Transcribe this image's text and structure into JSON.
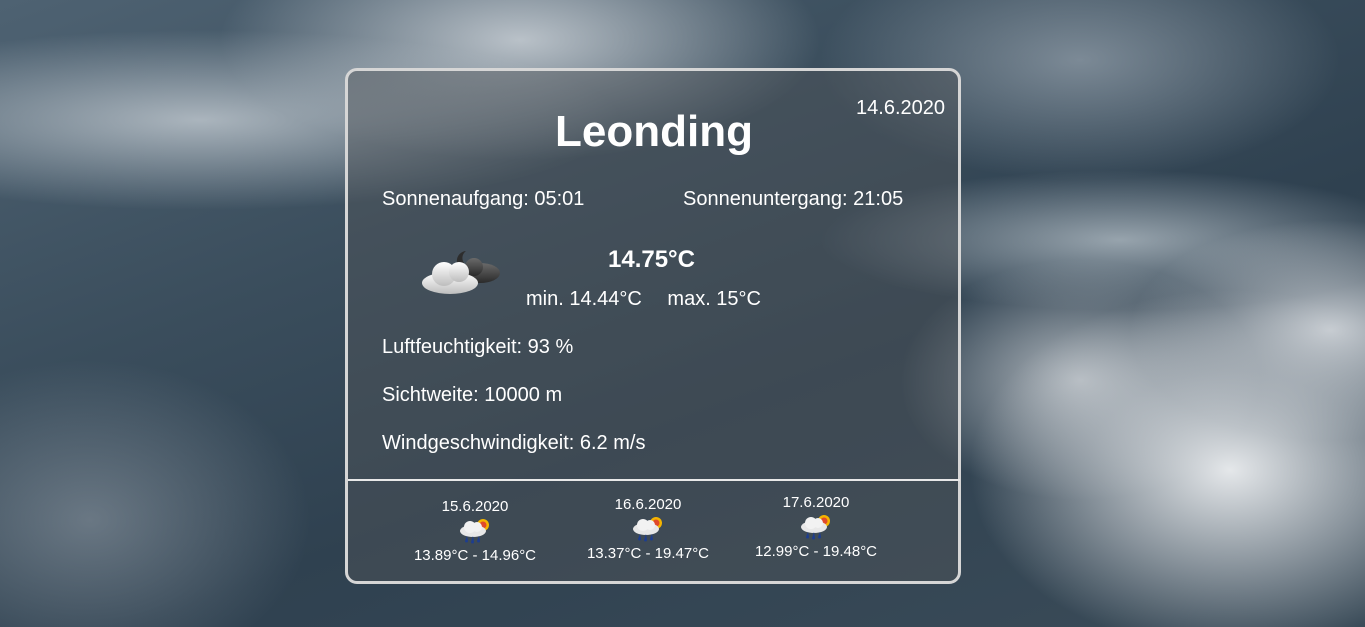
{
  "current": {
    "city": "Leonding",
    "date": "14.6.2020",
    "sunrise": "Sonnenaufgang: 05:01",
    "sunset": "Sonnenuntergang: 21:05",
    "icon": "cloudy-night-icon",
    "temperature": "14.75°C",
    "min": "min. 14.44°C",
    "max": "max. 15°C",
    "humidity": "Luftfeuchtigkeit: 93 %",
    "visibility": "Sichtweite: 10000 m",
    "wind": "Windgeschwindigkeit: 6.2 m/s"
  },
  "forecast": [
    {
      "date": "15.6.2020",
      "icon": "rain-sun-icon",
      "range": "13.89°C - 14.96°C"
    },
    {
      "date": "16.6.2020",
      "icon": "rain-sun-icon",
      "range": "13.37°C - 19.47°C"
    },
    {
      "date": "17.6.2020",
      "icon": "rain-sun-icon",
      "range": "12.99°C - 19.48°C"
    }
  ]
}
